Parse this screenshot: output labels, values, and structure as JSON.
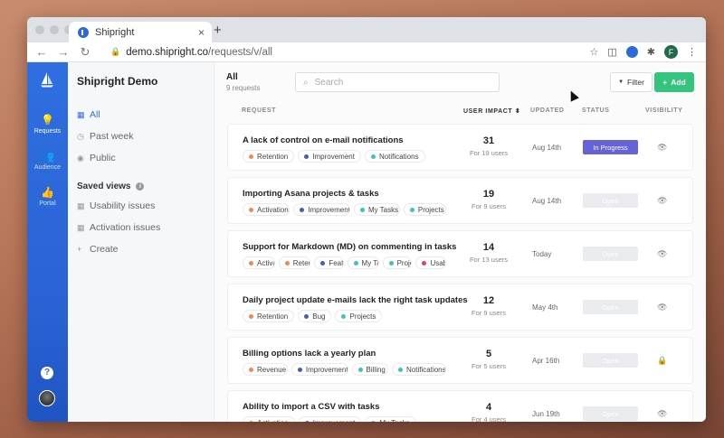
{
  "browser": {
    "tab_title": "Shipright",
    "new_tab": "+",
    "url_host": "demo.shipright.co",
    "url_path": "/requests/v/all",
    "profile_initial": "F",
    "close_glyph": "×",
    "nav_back": "←",
    "nav_forward": "→",
    "nav_reload": "↻",
    "lock_glyph": "🔒",
    "star_glyph": "☆",
    "pocket_glyph": "◫",
    "puzzle_glyph": "✱",
    "menu_glyph": "⋮"
  },
  "rail": {
    "items": [
      {
        "label": "Requests",
        "icon": "lightbulb-icon",
        "glyph": "💡"
      },
      {
        "label": "Audience",
        "icon": "users-icon",
        "glyph": "👥"
      },
      {
        "label": "Portal",
        "icon": "thumbs-up-icon",
        "glyph": "👍"
      }
    ],
    "help": "?"
  },
  "sidebar": {
    "title": "Shipright Demo",
    "views": [
      {
        "label": "All",
        "glyph": "▦"
      },
      {
        "label": "Past week",
        "glyph": "◷"
      },
      {
        "label": "Public",
        "glyph": "◉"
      }
    ],
    "saved_views_label": "Saved views",
    "info_glyph": "i",
    "saved": [
      {
        "label": "Usability issues",
        "glyph": "▦"
      },
      {
        "label": "Activation issues",
        "glyph": "▦"
      }
    ],
    "create_label": "Create",
    "create_glyph": "+"
  },
  "header": {
    "title": "All",
    "count": "9 requests",
    "search_placeholder": "Search",
    "search_glyph": "⌕",
    "filter_label": "Filter",
    "filter_glyph": "▼",
    "add_label": "Add",
    "add_glyph": "+"
  },
  "columns": {
    "request": "REQUEST",
    "user_impact": "USER IMPACT ⬍",
    "updated": "UPDATED",
    "status": "STATUS",
    "visibility": "VISIBILITY"
  },
  "tag_colors": {
    "Retention": "#f0895a",
    "Improvement": "#4a5bb0",
    "Notifications": "#3cc4b8",
    "Activation": "#f0895a",
    "My Tasks": "#3cc4b8",
    "Projects": "#3cc4b8",
    "Feature": "#4a5bb0",
    "Usability": "#d6406a",
    "Bug": "#4a5bb0",
    "Revenue": "#f0895a",
    "Billing": "#3cc4b8"
  },
  "vis_glyphs": {
    "public": "👁",
    "private": "🔒"
  },
  "requests": [
    {
      "title": "A lack of control on e-mail notifications",
      "tags": [
        "Retention",
        "Improvement",
        "Notifications"
      ],
      "impact": "31",
      "users": "For 19 users",
      "updated": "Aug 14th",
      "status": "In Progress",
      "status_kind": "progress",
      "visibility": "public"
    },
    {
      "title": "Importing Asana projects & tasks",
      "tags": [
        "Activation",
        "Improvement",
        "My Tasks",
        "Projects"
      ],
      "impact": "19",
      "users": "For 9 users",
      "updated": "Aug 14th",
      "status": "Open",
      "status_kind": "open",
      "visibility": "public"
    },
    {
      "title": "Support for Markdown (MD) on commenting in tasks",
      "tags": [
        "Activation",
        "Retention",
        "Feature",
        "My Tasks",
        "Projects",
        "Usability"
      ],
      "impact": "14",
      "users": "For 13 users",
      "updated": "Today",
      "status": "Open",
      "status_kind": "open",
      "visibility": "public"
    },
    {
      "title": "Daily project update e-mails lack the right task updates",
      "tags": [
        "Retention",
        "Bug",
        "Projects"
      ],
      "impact": "12",
      "users": "For 9 users",
      "updated": "May 4th",
      "status": "Open",
      "status_kind": "open",
      "visibility": "public"
    },
    {
      "title": "Billing options lack a yearly plan",
      "tags": [
        "Revenue",
        "Improvement",
        "Billing",
        "Notifications"
      ],
      "impact": "5",
      "users": "For 5 users",
      "updated": "Apr 16th",
      "status": "Open",
      "status_kind": "open",
      "visibility": "private"
    },
    {
      "title": "Ability to import a CSV with tasks",
      "tags": [
        "Activation",
        "Improvement",
        "My Tasks"
      ],
      "impact": "4",
      "users": "For 4 users",
      "updated": "Jun 19th",
      "status": "Open",
      "status_kind": "open",
      "visibility": "public"
    }
  ]
}
